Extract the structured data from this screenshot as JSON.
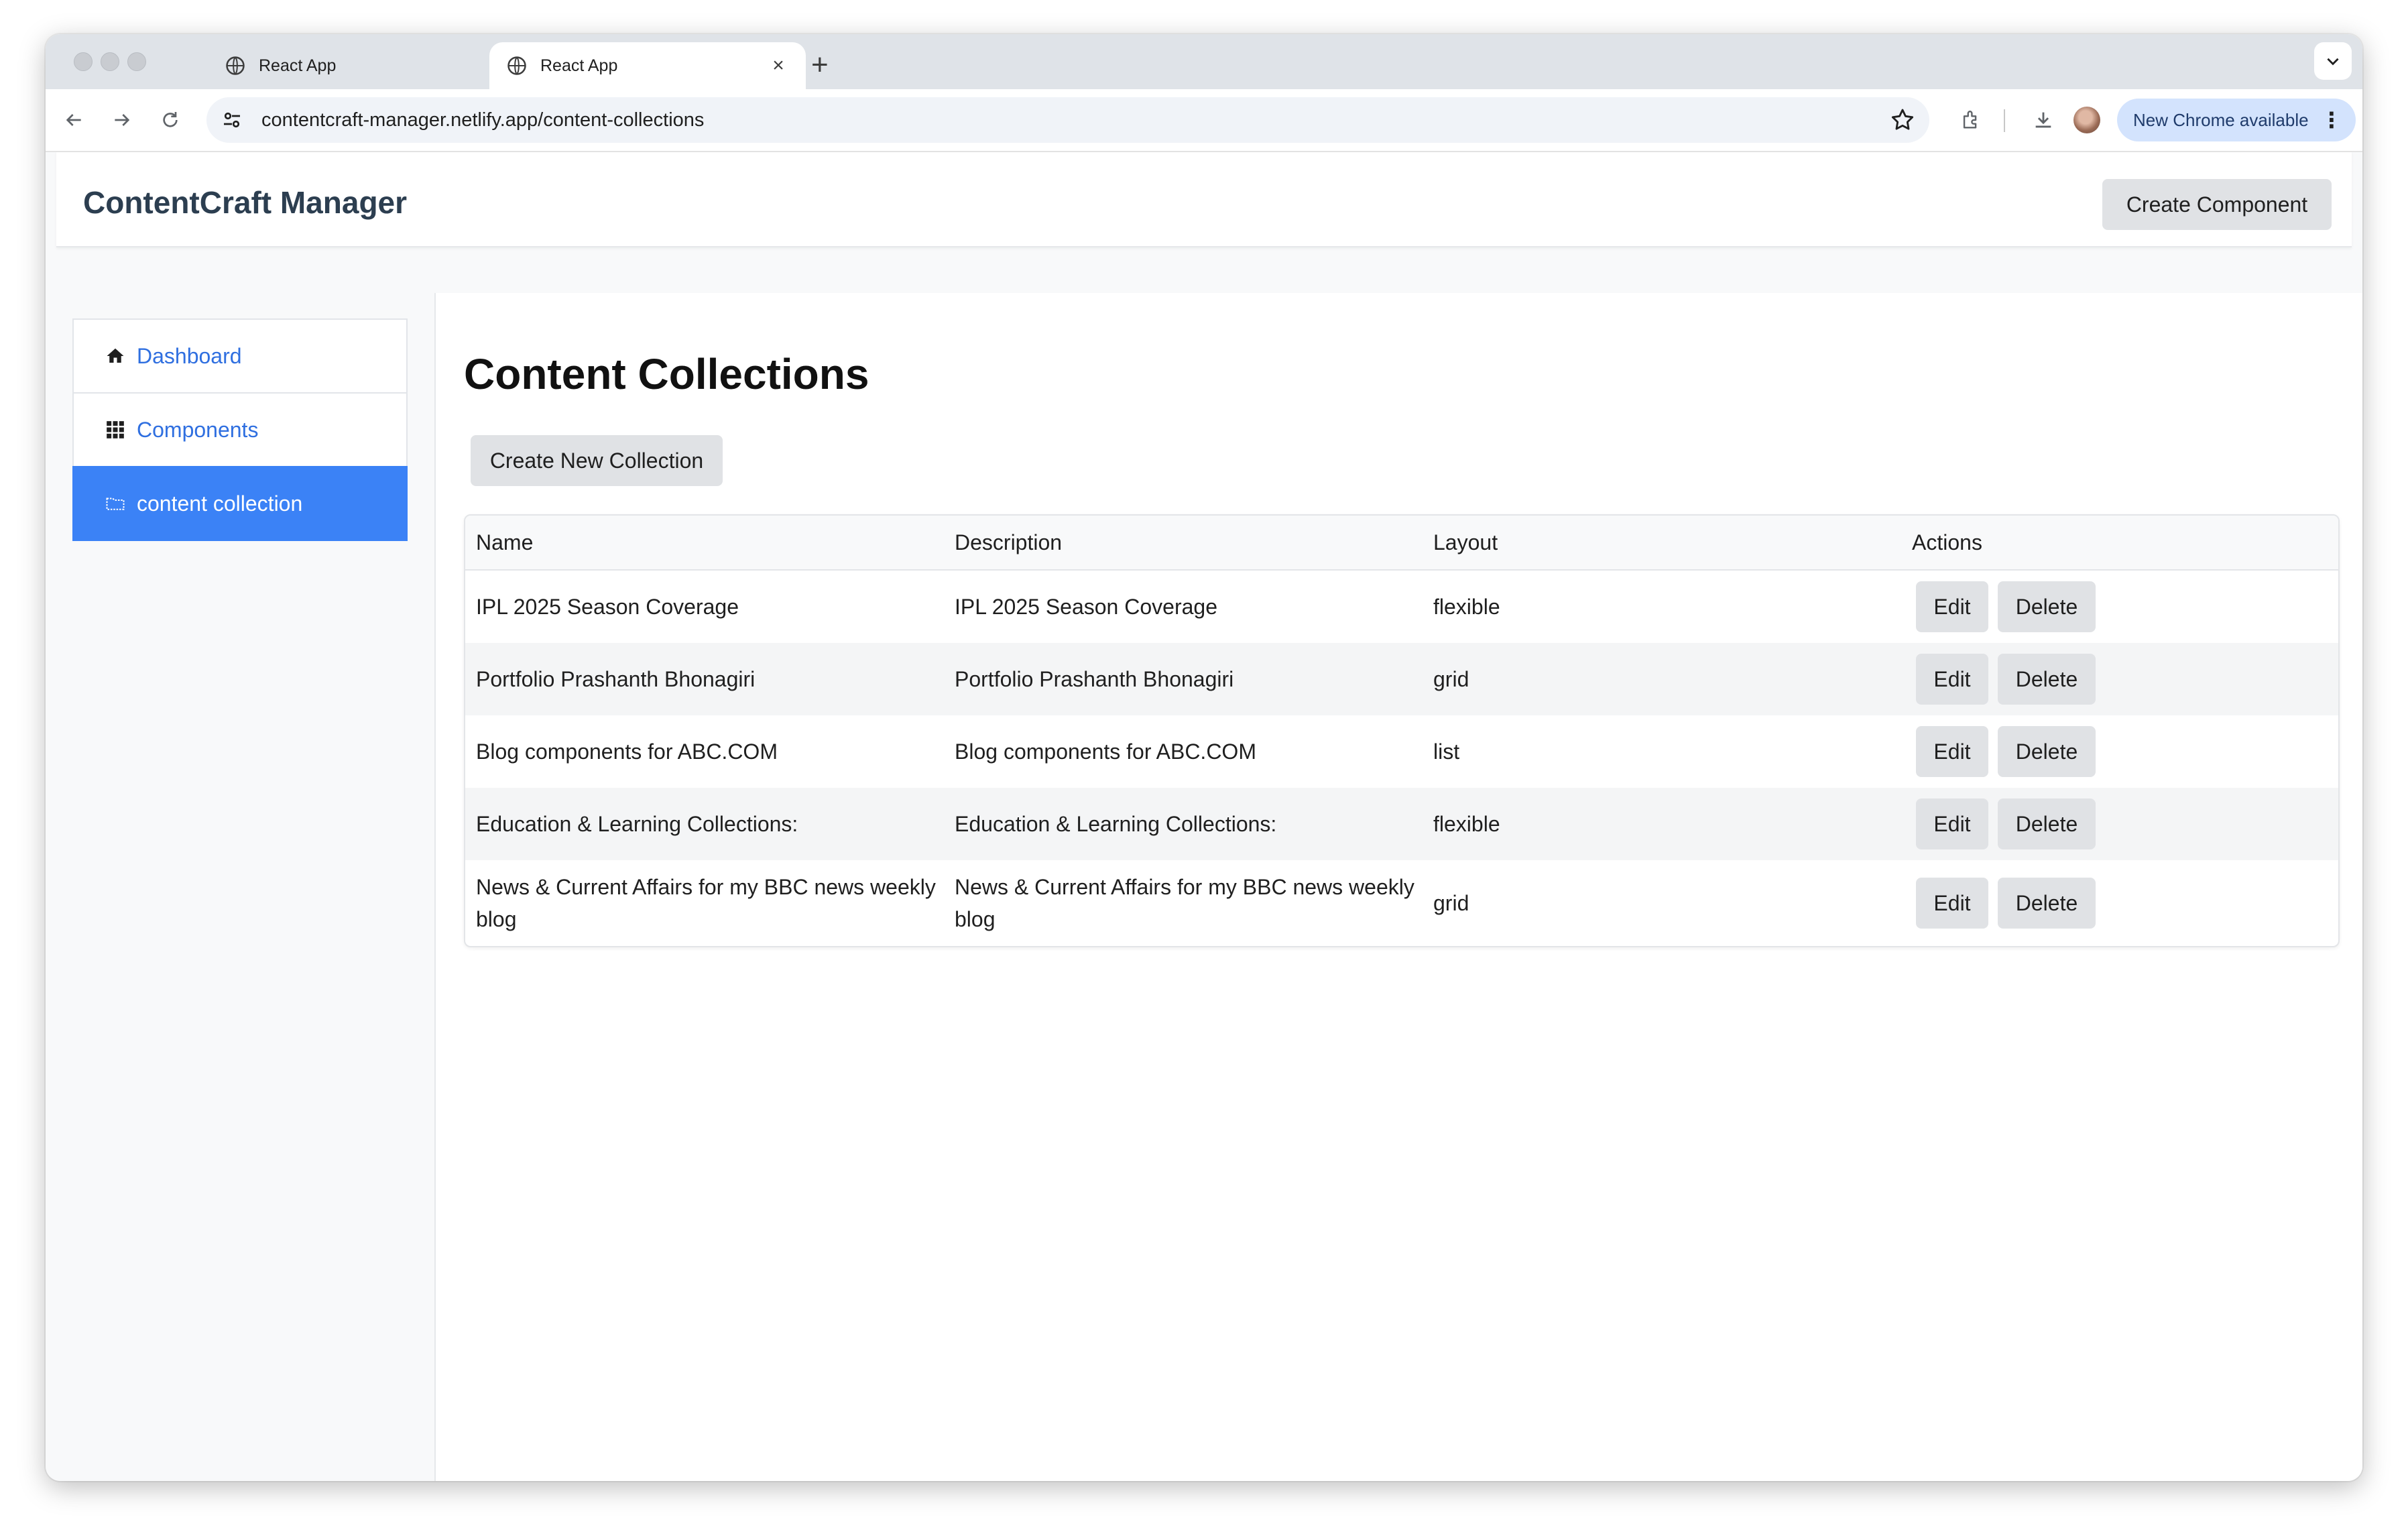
{
  "browser": {
    "tabs": [
      {
        "title": "React App",
        "close": "×",
        "active": false
      },
      {
        "title": "React App",
        "close": "×",
        "active": true
      }
    ],
    "new_tab": "+",
    "url": "contentcraft-manager.netlify.app/content-collections",
    "update_pill": "New Chrome available",
    "update_menu": "⋮",
    "icons": [
      "back-icon",
      "forward-icon",
      "reload-icon",
      "site-settings-icon",
      "bookmark-star-icon",
      "extensions-icon",
      "download-icon",
      "profile-avatar",
      "tab-search-chevron-icon"
    ]
  },
  "header": {
    "brand": "ContentCraft Manager",
    "create_component": "Create Component"
  },
  "sidebar": {
    "items": [
      {
        "label": "Dashboard",
        "icon": "home-icon",
        "active": false
      },
      {
        "label": "Components",
        "icon": "grid-icon",
        "active": false
      },
      {
        "label": "content collection",
        "icon": "folder-icon",
        "active": true
      }
    ]
  },
  "main": {
    "title": "Content Collections",
    "create_button": "Create New Collection",
    "columns": [
      "Name",
      "Description",
      "Layout",
      "Actions"
    ],
    "edit_label": "Edit",
    "delete_label": "Delete",
    "rows": [
      {
        "name": "IPL 2025 Season Coverage",
        "description": "IPL 2025 Season Coverage",
        "layout": "flexible"
      },
      {
        "name": "Portfolio Prashanth Bhonagiri",
        "description": "Portfolio Prashanth Bhonagiri",
        "layout": "grid"
      },
      {
        "name": "Blog components for ABC.COM",
        "description": "Blog components for ABC.COM",
        "layout": "list"
      },
      {
        "name": "Education & Learning Collections:",
        "description": "Education & Learning Collections:",
        "layout": "flexible"
      },
      {
        "name": "News & Current Affairs for my BBC news weekly blog",
        "description": "News & Current Affairs for my BBC news weekly blog",
        "layout": "grid"
      }
    ]
  },
  "colors": {
    "accent": "#3b82f6",
    "link": "#2f6fe0",
    "button_bg": "#e0e2e5",
    "brand_text": "#2c3e50"
  }
}
